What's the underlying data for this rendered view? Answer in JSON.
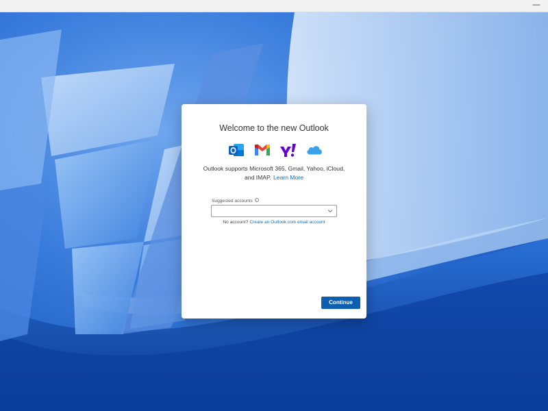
{
  "window": {
    "minimize_label": "—"
  },
  "dialog": {
    "title": "Welcome to the new Outlook",
    "providers": [
      "outlook-icon",
      "gmail-icon",
      "yahoo-icon",
      "icloud-icon"
    ],
    "description": "Outlook supports Microsoft 365, Gmail, Yahoo, iCloud, and IMAP.",
    "learn_more": "Learn More",
    "suggested_label": "Suggested accounts",
    "info_glyph": "i",
    "select_value": "",
    "no_account_text": "No account?",
    "create_link": "Create an Outlook.com email account",
    "continue_label": "Continue"
  },
  "colors": {
    "accent": "#0f6cbd",
    "button": "#0f5fb0",
    "outlook": "#0a64c8",
    "yahoo": "#6001d2",
    "icloud": "#3aa3ec"
  }
}
